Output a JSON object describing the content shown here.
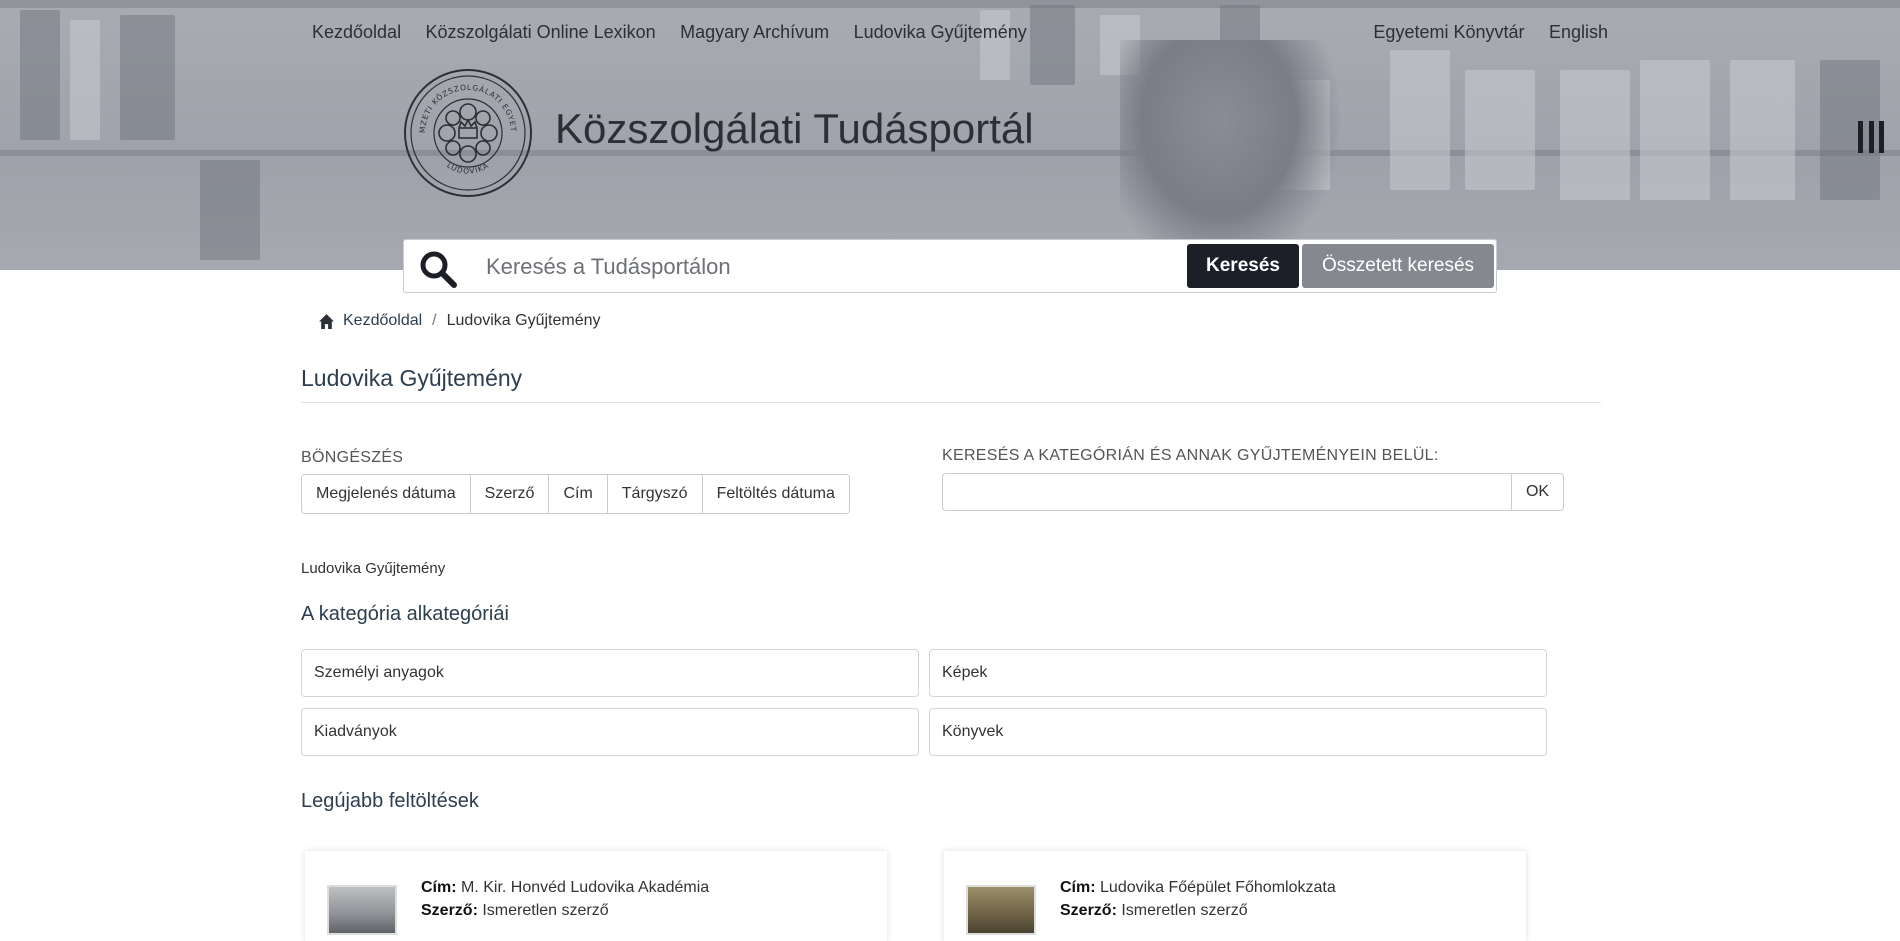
{
  "header": {
    "nav_left": [
      "Kezdőoldal",
      "Közszolgálati Online Lexikon",
      "Magyary Archívum",
      "Ludovika Gyűjtemény"
    ],
    "nav_right": [
      "Egyetemi Könyvtár",
      "English"
    ],
    "site_title": "Közszolgálati Tudásportál",
    "logo_text_top": "NEMZETI KÖZSZOLGÁLATI EGYETEM",
    "logo_text_bottom": "LUDOVIKA"
  },
  "search": {
    "placeholder": "Keresés a Tudásportálon",
    "submit_label": "Keresés",
    "advanced_label": "Összetett keresés"
  },
  "breadcrumb": {
    "home": "Kezdőoldal",
    "separator": "/",
    "current": "Ludovika Gyűjtemény"
  },
  "page": {
    "title": "Ludovika Gyűjtemény",
    "browse_label": "BÖNGÉSZÉS",
    "browse_options": [
      "Megjelenés dátuma",
      "Szerző",
      "Cím",
      "Tárgyszó",
      "Feltöltés dátuma"
    ],
    "scope_search_label": "KERESÉS A KATEGÓRIÁN ÉS ANNAK GYŰJTEMÉNYEIN BELÜL:",
    "scope_search_button": "OK",
    "collection_name": "Ludovika Gyűjtemény",
    "subcategories_heading": "A kategória alkategóriái",
    "subcategories": [
      "Személyi anyagok",
      "Képek",
      "Kiadványok",
      "Könyvek"
    ],
    "latest_heading": "Legújabb feltöltések"
  },
  "latest_items": [
    {
      "title_label": "Cím:",
      "title": "M. Kir. Honvéd Ludovika Akadémia",
      "author_label": "Szerző:",
      "author": "Ismeretlen szerző"
    },
    {
      "title_label": "Cím:",
      "title": "Ludovika Főépület Főhomlokzata",
      "author_label": "Szerző:",
      "author": "Ismeretlen szerző"
    }
  ],
  "colors": {
    "banner": "#a3a6ad",
    "primary_button": "#1c1f28",
    "secondary_button": "#868890",
    "heading": "#2c3e50"
  }
}
